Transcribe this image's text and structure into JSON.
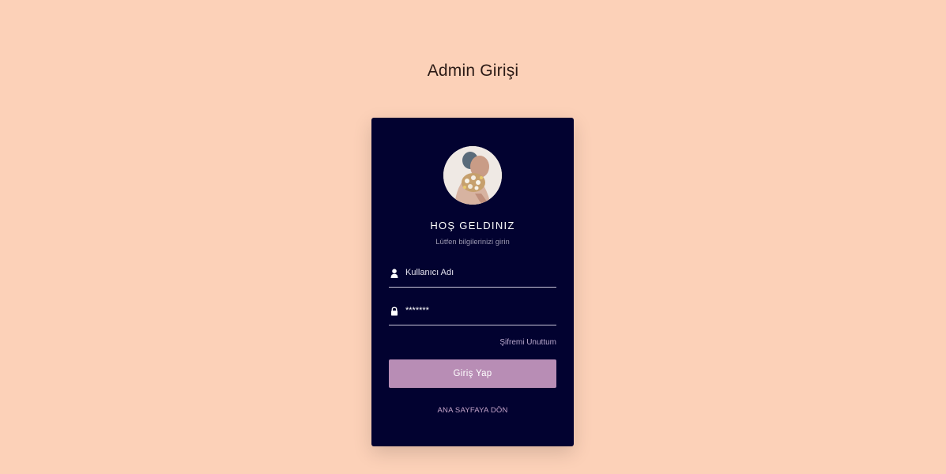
{
  "page": {
    "title": "Admin Girişi"
  },
  "card": {
    "avatar_icon": "profile-photo",
    "welcome": "HOŞ GELDINIZ",
    "subtitle": "Lütfen bilgilerinizi girin",
    "username": {
      "icon": "user-icon",
      "placeholder": "Kullanıcı Adı",
      "value": ""
    },
    "password": {
      "icon": "lock-icon",
      "placeholder": "",
      "value": "*******"
    },
    "forgot_label": "Şifremi Unuttum",
    "login_label": "Giriş Yap",
    "home_label": "ANA SAYFAYA DÖN"
  },
  "colors": {
    "background": "#fcd1b8",
    "card": "#020230",
    "button": "#b88db5",
    "link": "#b9a7cc"
  }
}
